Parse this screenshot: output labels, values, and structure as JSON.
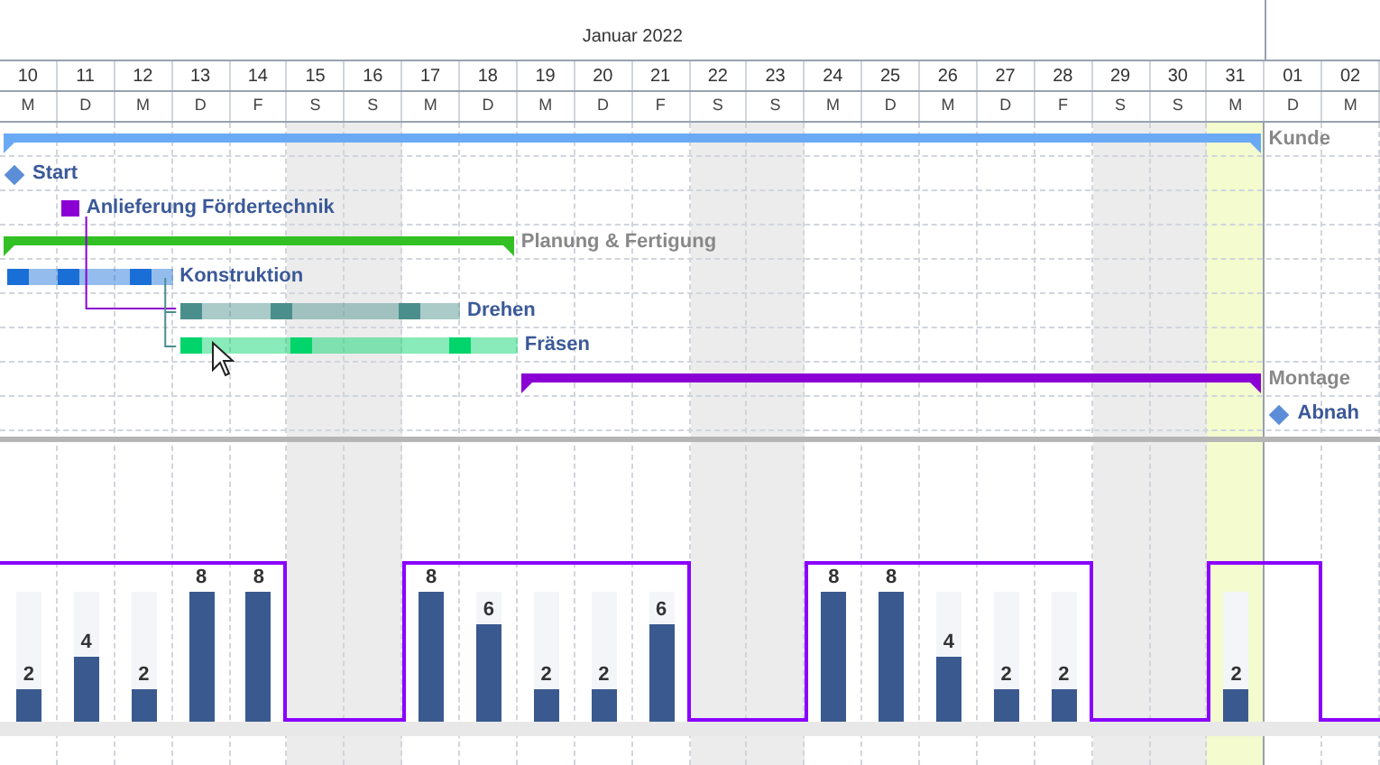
{
  "timeline": {
    "month": "Januar 2022",
    "days": [
      {
        "number": "10",
        "weekday": "M",
        "weekend": false,
        "highlighted": false,
        "capacity": true,
        "load": {
          "label": "2",
          "level": 0.25
        }
      },
      {
        "number": "11",
        "weekday": "D",
        "weekend": false,
        "highlighted": false,
        "capacity": true,
        "load": {
          "label": "4",
          "level": 0.5
        }
      },
      {
        "number": "12",
        "weekday": "M",
        "weekend": false,
        "highlighted": false,
        "capacity": true,
        "load": {
          "label": "2",
          "level": 0.25
        }
      },
      {
        "number": "13",
        "weekday": "D",
        "weekend": false,
        "highlighted": false,
        "capacity": true,
        "load": {
          "label": "8",
          "level": 1
        }
      },
      {
        "number": "14",
        "weekday": "F",
        "weekend": false,
        "highlighted": false,
        "capacity": true,
        "load": {
          "label": "8",
          "level": 1
        }
      },
      {
        "number": "15",
        "weekday": "S",
        "weekend": true,
        "highlighted": false,
        "capacity": false
      },
      {
        "number": "16",
        "weekday": "S",
        "weekend": true,
        "highlighted": false,
        "capacity": false
      },
      {
        "number": "17",
        "weekday": "M",
        "weekend": false,
        "highlighted": false,
        "capacity": true,
        "load": {
          "label": "8",
          "level": 1
        }
      },
      {
        "number": "18",
        "weekday": "D",
        "weekend": false,
        "highlighted": false,
        "capacity": true,
        "load": {
          "label": "6",
          "level": 0.75
        }
      },
      {
        "number": "19",
        "weekday": "M",
        "weekend": false,
        "highlighted": false,
        "capacity": true,
        "load": {
          "label": "2",
          "level": 0.25
        }
      },
      {
        "number": "20",
        "weekday": "D",
        "weekend": false,
        "highlighted": false,
        "capacity": true,
        "load": {
          "label": "2",
          "level": 0.25
        }
      },
      {
        "number": "21",
        "weekday": "F",
        "weekend": false,
        "highlighted": false,
        "capacity": true,
        "load": {
          "label": "6",
          "level": 0.75
        }
      },
      {
        "number": "22",
        "weekday": "S",
        "weekend": true,
        "highlighted": false,
        "capacity": false
      },
      {
        "number": "23",
        "weekday": "S",
        "weekend": true,
        "highlighted": false,
        "capacity": false
      },
      {
        "number": "24",
        "weekday": "M",
        "weekend": false,
        "highlighted": false,
        "capacity": true,
        "load": {
          "label": "8",
          "level": 1
        }
      },
      {
        "number": "25",
        "weekday": "D",
        "weekend": false,
        "highlighted": false,
        "capacity": true,
        "load": {
          "label": "8",
          "level": 1
        }
      },
      {
        "number": "26",
        "weekday": "M",
        "weekend": false,
        "highlighted": false,
        "capacity": true,
        "load": {
          "label": "4",
          "level": 0.5
        }
      },
      {
        "number": "27",
        "weekday": "D",
        "weekend": false,
        "highlighted": false,
        "capacity": true,
        "load": {
          "label": "2",
          "level": 0.25
        }
      },
      {
        "number": "28",
        "weekday": "F",
        "weekend": false,
        "highlighted": false,
        "capacity": true,
        "load": {
          "label": "2",
          "level": 0.25
        }
      },
      {
        "number": "29",
        "weekday": "S",
        "weekend": true,
        "highlighted": false,
        "capacity": false
      },
      {
        "number": "30",
        "weekday": "S",
        "weekend": true,
        "highlighted": false,
        "capacity": false
      },
      {
        "number": "31",
        "weekday": "M",
        "weekend": false,
        "highlighted": true,
        "capacity": true,
        "load": {
          "label": "2",
          "level": 0.25
        }
      },
      {
        "number": "01",
        "weekday": "D",
        "weekend": false,
        "highlighted": false,
        "capacity": true
      },
      {
        "number": "02",
        "weekday": "M",
        "weekend": false,
        "highlighted": false,
        "capacity": false
      }
    ]
  },
  "tasks": [
    {
      "label": "Kunde",
      "kind": "summary",
      "color": "#6aaaf5"
    },
    {
      "label": "Start",
      "kind": "milestone",
      "color": "#5b8ed6"
    },
    {
      "label": "Anlieferung Fördertechnik",
      "kind": "marker",
      "color": "#8a00d4"
    },
    {
      "label": "Planung & Fertigung",
      "kind": "summary",
      "color": "#33c024"
    },
    {
      "label": "Konstruktion",
      "kind": "bar",
      "color": "#1a6fd6"
    },
    {
      "label": "Drehen",
      "kind": "bar",
      "color": "#4a8f8c"
    },
    {
      "label": "Fräsen",
      "kind": "bar",
      "color": "#00d46a"
    },
    {
      "label": "Montage",
      "kind": "summary",
      "color": "#8a00d4"
    },
    {
      "label": "Abnah",
      "kind": "milestone",
      "color": "#5b8ed6"
    }
  ]
}
